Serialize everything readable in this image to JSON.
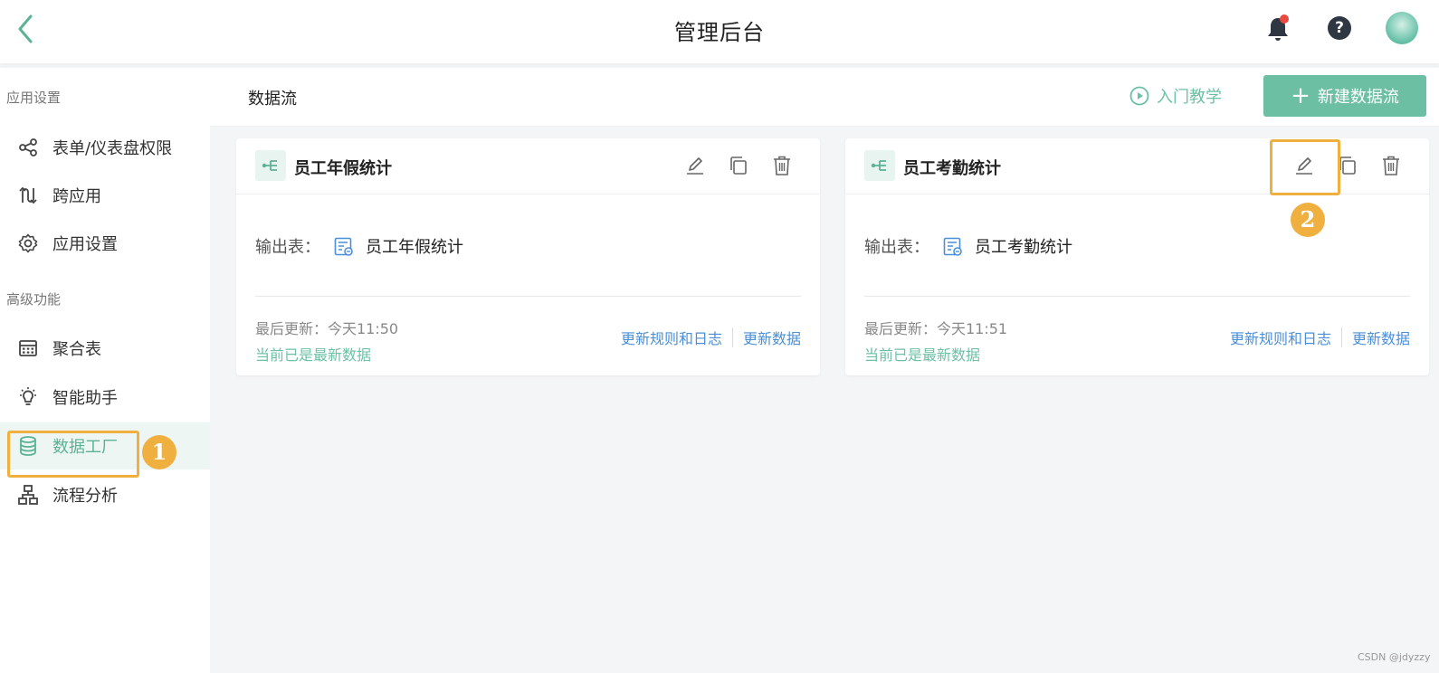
{
  "header": {
    "title": "管理后台"
  },
  "sidebar": {
    "section_app": "应用设置",
    "section_advanced": "高级功能",
    "items": [
      {
        "label": "表单/仪表盘权限",
        "icon": "share-icon"
      },
      {
        "label": "跨应用",
        "icon": "cross-app-icon"
      },
      {
        "label": "应用设置",
        "icon": "gear-icon"
      },
      {
        "label": "聚合表",
        "icon": "grid-table-icon"
      },
      {
        "label": "智能助手",
        "icon": "bulb-icon"
      },
      {
        "label": "数据工厂",
        "icon": "database-icon",
        "active": true
      },
      {
        "label": "流程分析",
        "icon": "org-chart-icon"
      }
    ]
  },
  "annotations": {
    "step1": "1",
    "step2": "2",
    "highlight_color": "#efb040"
  },
  "content": {
    "title": "数据流",
    "tutorial_label": "入门教学",
    "new_button_label": "新建数据流"
  },
  "cards": [
    {
      "title": "员工年假统计",
      "output_label": "输出表：",
      "output_table": "员工年假统计",
      "updated": "最后更新：今天11:50",
      "status": "当前已是最新数据",
      "link_rules": "更新规则和日志",
      "link_update": "更新数据"
    },
    {
      "title": "员工考勤统计",
      "output_label": "输出表：",
      "output_table": "员工考勤统计",
      "updated": "最后更新：今天11:51",
      "status": "当前已是最新数据",
      "link_rules": "更新规则和日志",
      "link_update": "更新数据"
    }
  ],
  "colors": {
    "accent": "#6cbfa2",
    "link": "#4a8fd8",
    "notification": "#e84a3f"
  },
  "watermark": "CSDN @jdyzzy"
}
